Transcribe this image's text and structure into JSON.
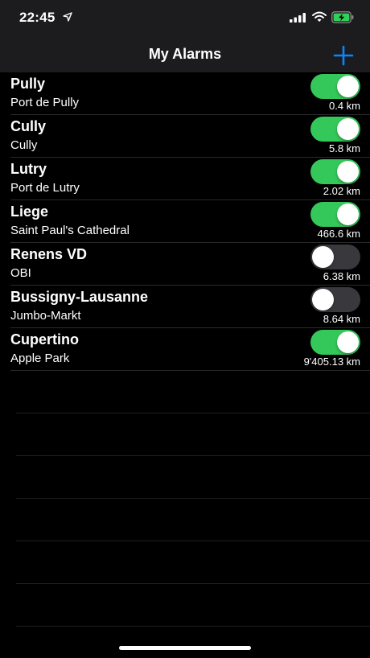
{
  "status_bar": {
    "time": "22:45",
    "icons": [
      "location-arrow-icon",
      "cellular-signal-icon",
      "wifi-icon",
      "battery-charging-icon"
    ]
  },
  "nav": {
    "title": "My Alarms",
    "add_icon": "plus-icon"
  },
  "colors": {
    "accent": "#0a84ff",
    "toggle_on": "#34c759",
    "toggle_off": "#39393d"
  },
  "alarms": [
    {
      "name": "Pully",
      "place": "Port de Pully",
      "distance": "0.4 km",
      "enabled": true
    },
    {
      "name": "Cully",
      "place": "Cully",
      "distance": "5.8 km",
      "enabled": true
    },
    {
      "name": "Lutry",
      "place": "Port de Lutry",
      "distance": "2.02 km",
      "enabled": true
    },
    {
      "name": "Liege",
      "place": "Saint Paul's Cathedral",
      "distance": "466.6 km",
      "enabled": true
    },
    {
      "name": "Renens VD",
      "place": "OBI",
      "distance": "6.38 km",
      "enabled": false
    },
    {
      "name": "Bussigny-Lausanne",
      "place": "Jumbo-Markt",
      "distance": "8.64 km",
      "enabled": false
    },
    {
      "name": "Cupertino",
      "place": "Apple Park",
      "distance": "9'405.13 km",
      "enabled": true
    }
  ]
}
